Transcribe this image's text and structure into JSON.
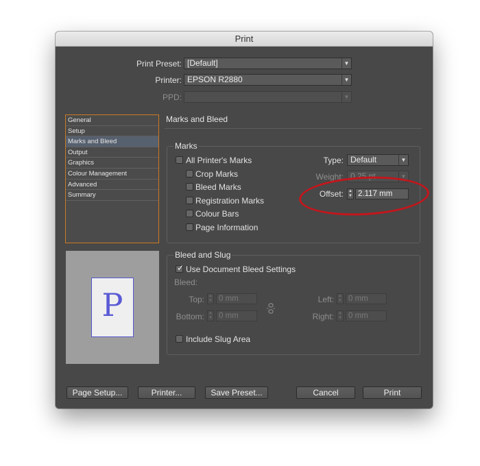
{
  "window": {
    "title": "Print"
  },
  "header": {
    "print_preset_label": "Print Preset:",
    "print_preset_value": "[Default]",
    "printer_label": "Printer:",
    "printer_value": "EPSON R2880",
    "ppd_label": "PPD:",
    "ppd_value": ""
  },
  "sidebar": {
    "items": [
      {
        "label": "General",
        "selected": false
      },
      {
        "label": "Setup",
        "selected": false
      },
      {
        "label": "Marks and Bleed",
        "selected": true
      },
      {
        "label": "Output",
        "selected": false
      },
      {
        "label": "Graphics",
        "selected": false
      },
      {
        "label": "Colour Management",
        "selected": false
      },
      {
        "label": "Advanced",
        "selected": false
      },
      {
        "label": "Summary",
        "selected": false
      }
    ]
  },
  "section_title": "Marks and Bleed",
  "marks": {
    "title": "Marks",
    "all_printers_marks": {
      "label": "All Printer's Marks",
      "checked": false
    },
    "crop_marks": {
      "label": "Crop Marks",
      "checked": false
    },
    "bleed_marks": {
      "label": "Bleed Marks",
      "checked": false
    },
    "registration_marks": {
      "label": "Registration Marks",
      "checked": false
    },
    "colour_bars": {
      "label": "Colour Bars",
      "checked": false
    },
    "page_information": {
      "label": "Page Information",
      "checked": false
    },
    "type_label": "Type:",
    "type_value": "Default",
    "weight_label": "Weight:",
    "weight_value": "0.25 pt",
    "offset_label": "Offset:",
    "offset_value": "2.117 mm"
  },
  "bleed": {
    "title": "Bleed and Slug",
    "use_document_bleed": {
      "label": "Use Document Bleed Settings",
      "checked": true
    },
    "bleed_label": "Bleed:",
    "top_label": "Top:",
    "top_value": "0 mm",
    "bottom_label": "Bottom:",
    "bottom_value": "0 mm",
    "left_label": "Left:",
    "left_value": "0 mm",
    "right_label": "Right:",
    "right_value": "0 mm",
    "include_slug": {
      "label": "Include Slug Area",
      "checked": false
    }
  },
  "preview": {
    "glyph": "P"
  },
  "buttons": {
    "page_setup": "Page Setup...",
    "printer": "Printer...",
    "save_preset": "Save Preset...",
    "cancel": "Cancel",
    "print": "Print"
  },
  "colors": {
    "window_bg": "#484848",
    "sidebar_border": "#cc7a22",
    "annotation_ring": "#c4161c",
    "preview_glyph": "#5b5bd6"
  },
  "icons": {
    "select_arrow": "chevron-down-icon",
    "link_bleed": "link-icon",
    "checkbox_tick": "checkmark-icon"
  }
}
